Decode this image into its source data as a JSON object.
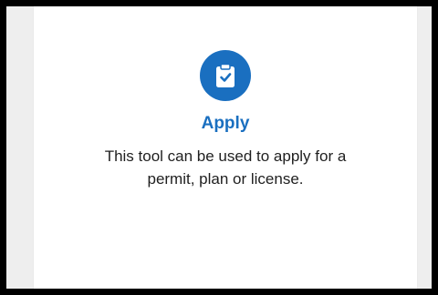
{
  "card": {
    "icon": "clipboard-check-icon",
    "title": "Apply",
    "description": "This tool can be used to apply for a permit, plan or license."
  },
  "colors": {
    "accent": "#1a6fc0",
    "text": "#1f1f1f",
    "background": "#eeeeee",
    "frame_border": "#000000"
  }
}
